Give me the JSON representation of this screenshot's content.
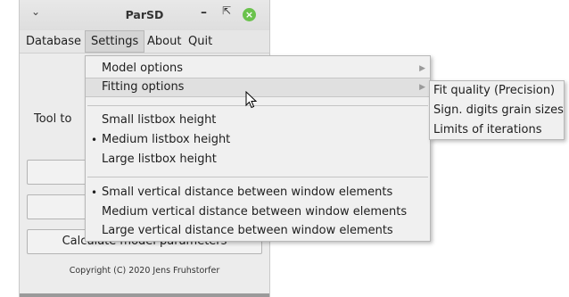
{
  "window": {
    "title": "ParSD",
    "menu_icon": "chevron-down-icon",
    "min_icon": "minimize-icon",
    "max_icon": "maximize-icon",
    "close_icon": "close-icon"
  },
  "menubar": {
    "items": [
      "Database",
      "Settings",
      "About",
      "Quit"
    ],
    "active": "Settings"
  },
  "main": {
    "tool_label": "Tool to",
    "calc_button": "Calculate model parameters",
    "copyright": "Copyright (C) 2020 Jens Fruhstorfer"
  },
  "settings_menu": {
    "items": [
      {
        "label": "Model options",
        "has_submenu": true
      },
      {
        "label": "Fitting options",
        "has_submenu": true,
        "highlighted": true
      },
      {
        "label": "Small listbox height",
        "checked": false
      },
      {
        "label": "Medium listbox height",
        "checked": true
      },
      {
        "label": "Large listbox height",
        "checked": false
      },
      {
        "label": "Small vertical distance between window elements",
        "checked": true
      },
      {
        "label": "Medium vertical distance between window elements",
        "checked": false
      },
      {
        "label": "Large vertical distance between window elements",
        "checked": false
      }
    ],
    "bullet": "•",
    "submenu_arrow": "▶"
  },
  "fitting_submenu": {
    "items": [
      "Fit quality (Precision)",
      "Sign. digits grain sizes",
      "Limits of iterations"
    ]
  },
  "colors": {
    "close_button": "#6ac24c",
    "menu_bg": "#f0f0f0",
    "highlight_bg": "#e0e0e0"
  }
}
